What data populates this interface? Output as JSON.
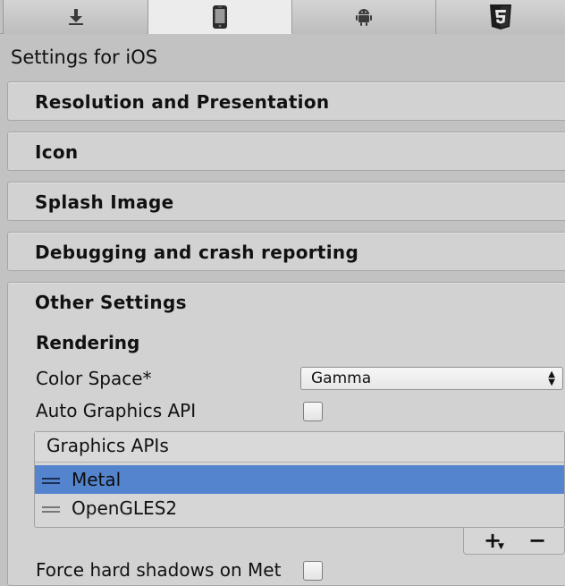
{
  "tabs": [
    {
      "icon": "download-icon",
      "active": false
    },
    {
      "icon": "phone-icon",
      "active": true
    },
    {
      "icon": "android-icon",
      "active": false
    },
    {
      "icon": "html5-icon",
      "active": false
    }
  ],
  "heading": "Settings for iOS",
  "sections": {
    "resolution": "Resolution and Presentation",
    "icon": "Icon",
    "splash": "Splash Image",
    "debugging": "Debugging and crash reporting",
    "other": "Other Settings"
  },
  "other_settings": {
    "rendering_label": "Rendering",
    "color_space_label": "Color Space*",
    "color_space_value": "Gamma",
    "auto_graphics_label": "Auto Graphics API",
    "auto_graphics_checked": false,
    "graphics_apis_header": "Graphics APIs",
    "graphics_apis": [
      "Metal",
      "OpenGLES2"
    ],
    "selected_api": "Metal",
    "add_label": "+",
    "remove_label": "−",
    "force_shadows_label": "Force hard shadows on Met",
    "force_shadows_checked": false
  }
}
